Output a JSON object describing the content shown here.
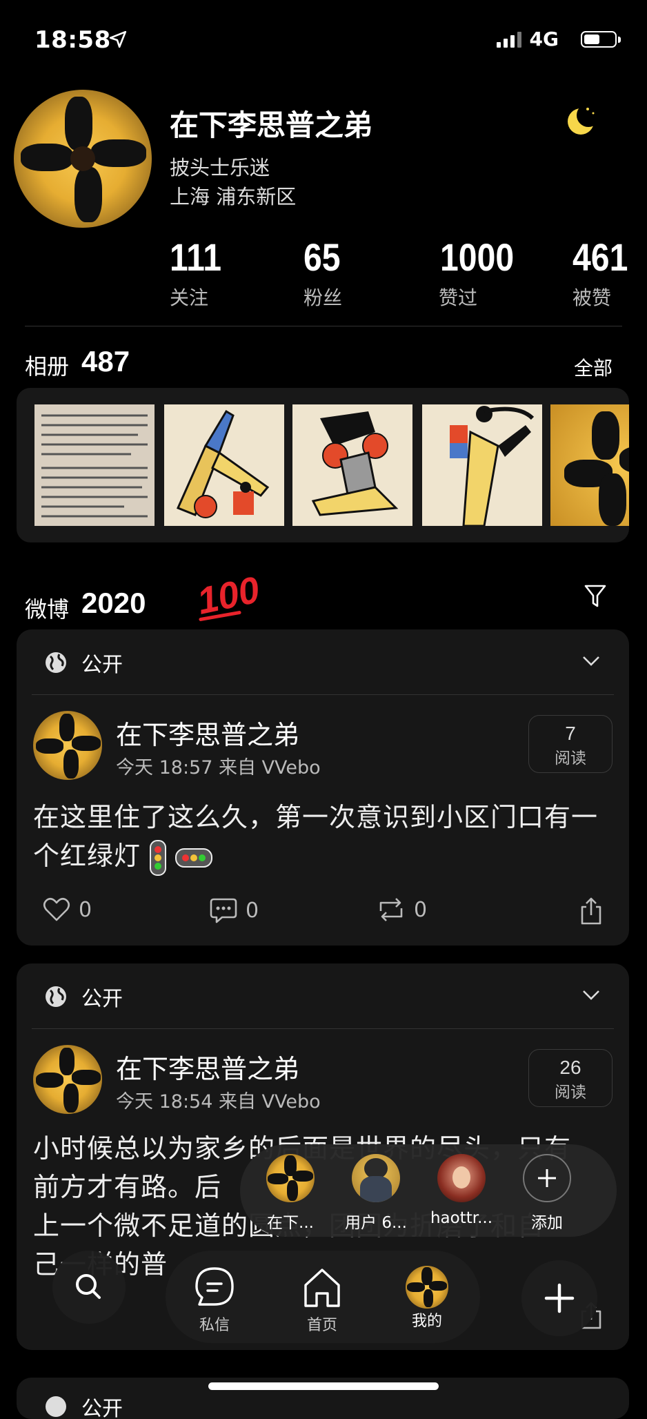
{
  "status_bar": {
    "time": "18:58",
    "network": "4G"
  },
  "profile": {
    "name": "在下李思普之弟",
    "bio": "披头士乐迷",
    "location": "上海 浦东新区",
    "stats": [
      {
        "value": "111",
        "label": "关注"
      },
      {
        "value": "65",
        "label": "粉丝"
      },
      {
        "value": "1000",
        "label": "赞过"
      },
      {
        "value": "461",
        "label": "被赞"
      }
    ]
  },
  "album": {
    "title": "相册",
    "count": "487",
    "all_label": "全部"
  },
  "weibo": {
    "title": "微博",
    "year": "2020",
    "emoji": "100"
  },
  "posts": [
    {
      "visibility": "公开",
      "author": "在下李思普之弟",
      "meta": "今天 18:57  来自 VVebo",
      "reads_num": "7",
      "reads_label": "阅读",
      "text": "在这里住了这么久，第一次意识到小区门口有一个红绿灯",
      "likes": "0",
      "comments": "0",
      "reposts": "0"
    },
    {
      "visibility": "公开",
      "author": "在下李思普之弟",
      "meta": "今天 18:54  来自 VVebo",
      "reads_num": "26",
      "reads_label": "阅读",
      "text_line1": "小时候总以为家乡的后面是世界的尽头，只有",
      "text_line2": "前方才有路。后",
      "text_line3": "上一个微不足道的圆点，团团为折磨了和自",
      "text_line4": "己一样的普"
    }
  ],
  "third_card_visibility": "公开",
  "switcher": {
    "accounts": [
      {
        "label": "在下..."
      },
      {
        "label": "用户 6..."
      },
      {
        "label": "haottr..."
      },
      {
        "label": "添加"
      }
    ]
  },
  "nav": {
    "messages": "私信",
    "home": "首页",
    "me": "我的"
  },
  "colors": {
    "accent_red": "#e8232b",
    "card": "#171717",
    "avatar_yellow": "#f6c74f"
  }
}
